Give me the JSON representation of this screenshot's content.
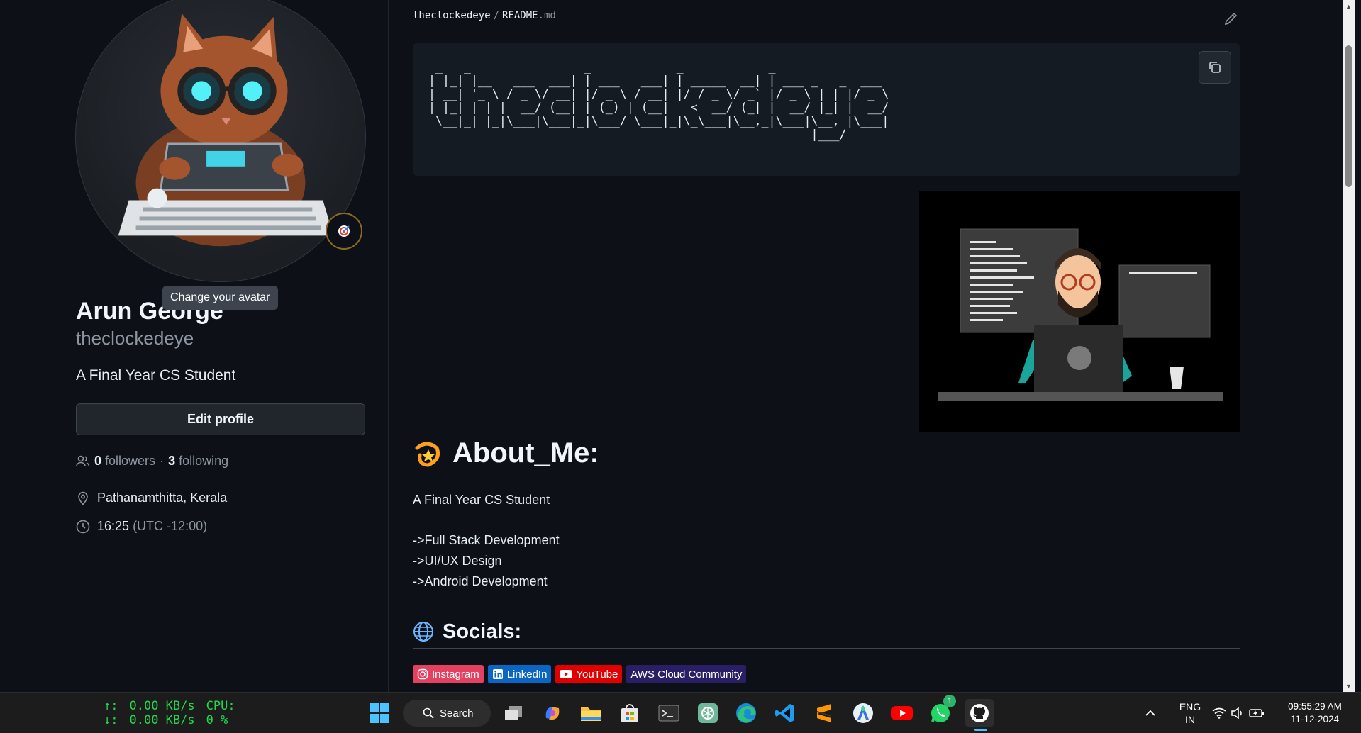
{
  "profile": {
    "name": "Arun George",
    "login": "theclockedeye",
    "bio": "A Final Year CS Student",
    "tooltip": "Change your avatar",
    "edit_button": "Edit profile",
    "followers_count": "0",
    "followers_label": "followers",
    "separator": "·",
    "following_count": "3",
    "following_label": "following",
    "location": "Pathanamthitta, Kerala",
    "local_time": "16:25",
    "timezone": "(UTC -12:00)"
  },
  "readme": {
    "owner": "theclockedeye",
    "file_name": "README",
    "file_ext": ".md",
    "ascii_art": " _   _                _            _            _\n| |_| |__   ___  ___| | ___   ___| | _____  __| | ___ _   _  ___\n| __| '_ \\ / _ \\/ __| |/ _ \\ / __| |/ / _ \\/ _` |/ _ \\ | | |/ _ \\\n| |_| | | |  __/ (__| | (_) | (__|   <  __/ (_| |  __/ |_| |  __/\n \\__|_| |_|\\___|\\___|_|\\___/ \\___|_|\\_\\___|\\__,_|\\___|\\__, |\\___|\n                                                      |___/",
    "about_heading": "About_Me:",
    "about_lines": [
      "A Final Year CS Student",
      "->Full Stack Development",
      "->UI/UX Design",
      "->Android Development"
    ],
    "socials_heading": "Socials:",
    "badges": [
      {
        "label": "Instagram",
        "color": "#E4405F"
      },
      {
        "label": "LinkedIn",
        "color": "#0A66C2"
      },
      {
        "label": "YouTube",
        "color": "#E00000"
      },
      {
        "label": "AWS Cloud Community",
        "color": "#232F3E"
      }
    ]
  },
  "taskbar": {
    "net_up": "0.00 KB/s",
    "net_down": "0.00 KB/s",
    "cpu_label": "CPU:",
    "cpu_value": "0 %",
    "search_label": "Search",
    "whatsapp_badge": "1",
    "lang_top": "ENG",
    "lang_bottom": "IN",
    "time": "09:55:29 AM",
    "date": "11-12-2024"
  },
  "colors": {
    "bg": "#0d1117",
    "accent_green": "#23d84d",
    "text_muted": "#8d96a0"
  }
}
